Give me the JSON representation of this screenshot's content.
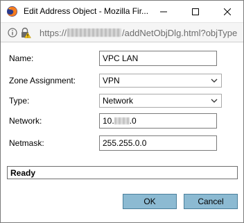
{
  "window": {
    "title": "Edit Address Object - Mozilla Fir..."
  },
  "urlbar": {
    "url_prefix": "https://",
    "url_suffix": "/addNetObjDlg.html?objType"
  },
  "form": {
    "name_label": "Name:",
    "name_value": "VPC LAN",
    "zone_label": "Zone Assignment:",
    "zone_value": "VPN",
    "type_label": "Type:",
    "type_value": "Network",
    "network_label": "Network:",
    "network_prefix": "10.",
    "network_suffix": ".0",
    "netmask_label": "Netmask:",
    "netmask_value": "255.255.0.0"
  },
  "status": {
    "text": "Ready"
  },
  "buttons": {
    "ok_label": "OK",
    "cancel_label": "Cancel"
  },
  "colors": {
    "button_bg": "#8cbad2",
    "button_border": "#4a7f9b",
    "warning_yellow": "#f5c518"
  },
  "icons": [
    "firefox-logo-icon",
    "minimize-icon",
    "maximize-icon",
    "close-icon",
    "info-icon",
    "insecure-lock-icon",
    "dropdown-caret-icon"
  ]
}
